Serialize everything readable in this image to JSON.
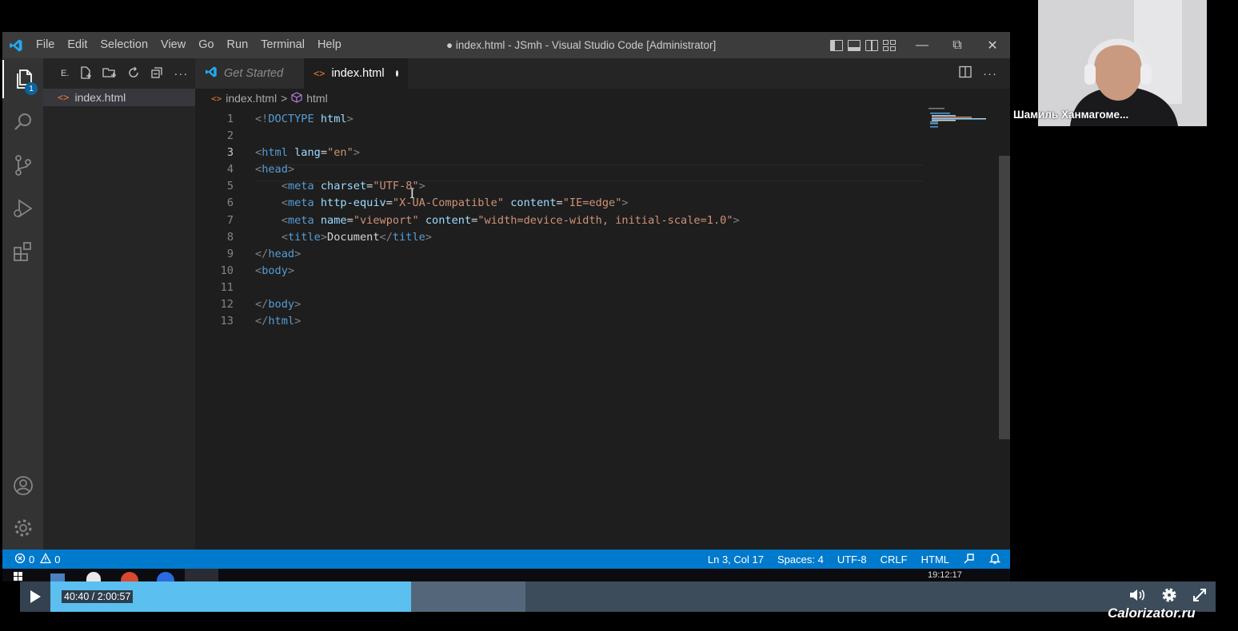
{
  "window": {
    "title": "● index.html - JSmh - Visual Studio Code [Administrator]",
    "menu": [
      "File",
      "Edit",
      "Selection",
      "View",
      "Go",
      "Run",
      "Terminal",
      "Help"
    ],
    "controls": {
      "minimize": "—",
      "restore": "⧉",
      "close": "✕"
    }
  },
  "activity_bar": {
    "items": [
      "explorer-icon",
      "search-icon",
      "source-control-icon",
      "run-debug-icon",
      "extensions-icon"
    ],
    "bottom_items": [
      "accounts-icon",
      "settings-gear-icon"
    ],
    "explorer_badge": "1"
  },
  "sidebar": {
    "label": "E.",
    "actions": [
      "new-file-icon",
      "new-folder-icon",
      "refresh-icon",
      "collapse-icon",
      "more-icon"
    ],
    "files": [
      {
        "name": "index.html",
        "icon": "html-icon"
      }
    ]
  },
  "tabs": [
    {
      "label": "Get Started",
      "icon": "vscode-icon",
      "active": false
    },
    {
      "label": "index.html",
      "icon": "html-icon",
      "active": true,
      "dirty": true
    }
  ],
  "breadcrumb": {
    "file": "index.html",
    "separator": ">",
    "symbol": "html"
  },
  "code": {
    "active_line": 3,
    "lines": [
      {
        "n": "1"
      },
      {
        "n": "2"
      },
      {
        "n": "3"
      },
      {
        "n": "4"
      },
      {
        "n": "5"
      },
      {
        "n": "6"
      },
      {
        "n": "7"
      },
      {
        "n": "8"
      },
      {
        "n": "9"
      },
      {
        "n": "10"
      },
      {
        "n": "11"
      },
      {
        "n": "12"
      },
      {
        "n": "13"
      }
    ],
    "tokens": {
      "doctype_open": "<!",
      "doctype_kw": "DOCTYPE",
      "doctype_rest": " html",
      "close_gt": ">",
      "html_tag": "html",
      "lang_attr": "lang",
      "lang_val": "\"en\"",
      "head_tag": "head",
      "meta_tag": "meta",
      "charset_attr": "charset",
      "charset_val": "\"UTF-8\"",
      "http_equiv_attr": "http-equiv",
      "http_equiv_val": "\"X-UA-Compatible\"",
      "content_attr": "content",
      "content_val1": "\"IE=edge\"",
      "name_attr": "name",
      "name_val": "\"viewport\"",
      "content_val2": "\"width=device-width, initial-scale=1.0\"",
      "title_tag": "title",
      "title_text": "Document",
      "body_tag": "body"
    }
  },
  "status": {
    "errors": "0",
    "warnings": "0",
    "position": "Ln 3, Col 17",
    "spaces": "Spaces: 4",
    "encoding": "UTF-8",
    "eol": "CRLF",
    "language": "HTML"
  },
  "taskbar": {
    "time": "19:12:17"
  },
  "webcam": {
    "name": "Шамиль Ханмагоме..."
  },
  "player": {
    "time": "40:40 / 2:00:57",
    "progress": 0.3,
    "buffered": 0.4
  },
  "watermark": "Calorizator.ru"
}
